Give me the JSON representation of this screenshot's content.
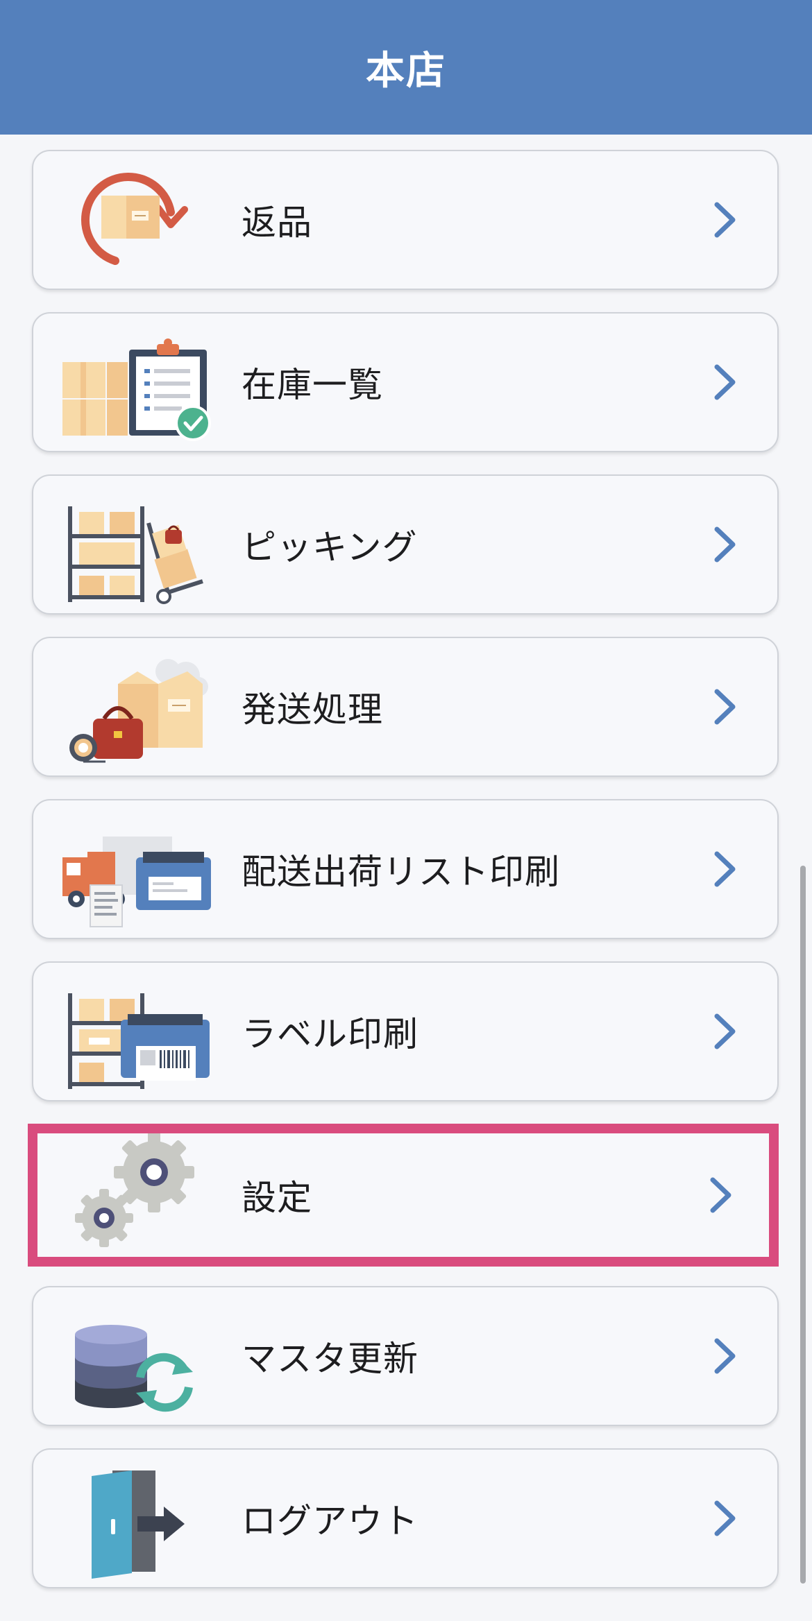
{
  "header": {
    "title": "本店"
  },
  "menu": {
    "items": [
      {
        "label": "返品",
        "icon": "return-box-icon"
      },
      {
        "label": "在庫一覧",
        "icon": "inventory-clipboard-icon"
      },
      {
        "label": "ピッキング",
        "icon": "picking-shelf-icon"
      },
      {
        "label": "発送処理",
        "icon": "shipping-box-icon"
      },
      {
        "label": "配送出荷リスト印刷",
        "icon": "truck-printer-icon"
      },
      {
        "label": "ラベル印刷",
        "icon": "label-printer-icon"
      },
      {
        "label": "設定",
        "icon": "gear-icon",
        "highlighted": true
      },
      {
        "label": "マスタ更新",
        "icon": "database-sync-icon"
      },
      {
        "label": "ログアウト",
        "icon": "logout-door-icon"
      }
    ]
  },
  "colors": {
    "header_bg": "#5480bc",
    "chevron": "#5480bc",
    "highlight_border": "#d94c7e",
    "page_bg": "#f5f6f9"
  }
}
